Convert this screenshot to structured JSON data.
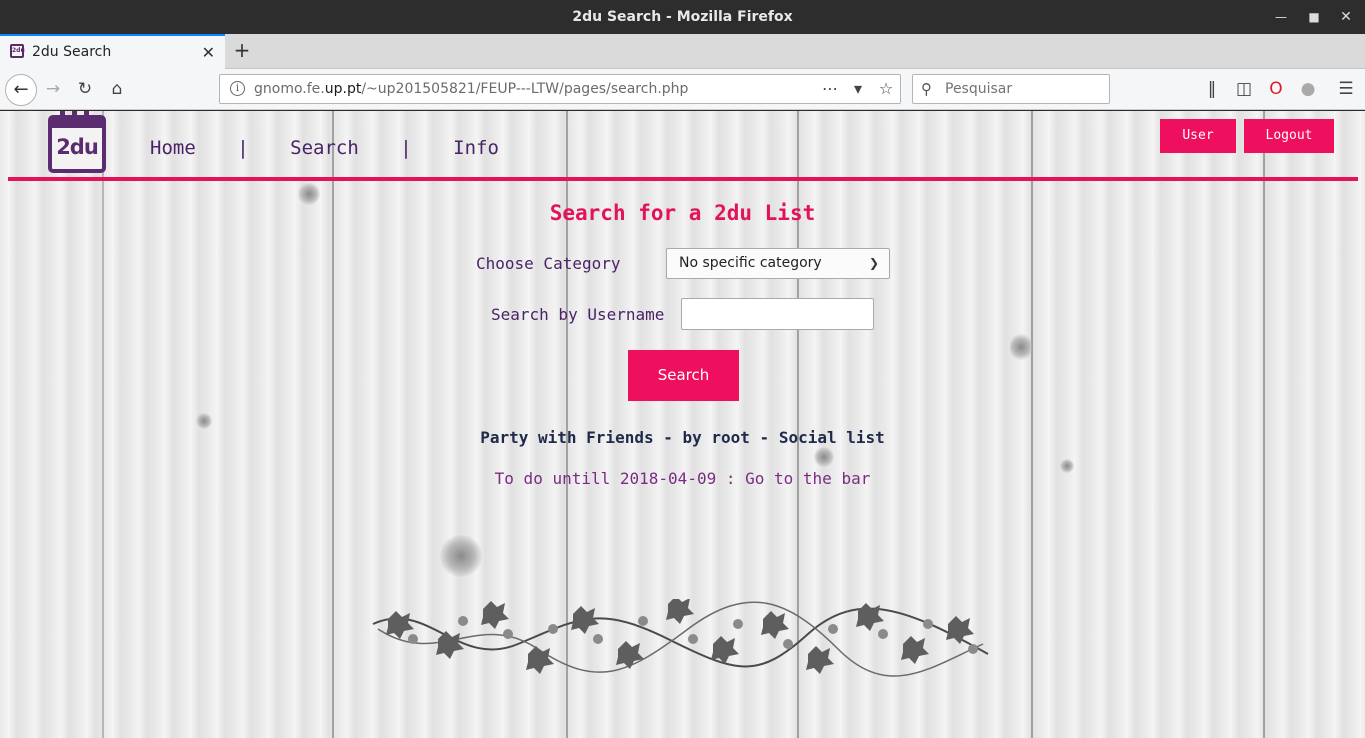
{
  "window": {
    "title": "2du Search - Mozilla Firefox"
  },
  "browser": {
    "tab_title": "2du Search",
    "url_host_prefix": "gnomo.fe.",
    "url_host_domain": "up.pt",
    "url_path": "/~up201505821/FEUP---LTW/pages/search.php",
    "search_placeholder": "Pesquisar"
  },
  "site": {
    "logo_text": "2du",
    "nav": [
      {
        "label": "Home"
      },
      {
        "label": "|"
      },
      {
        "label": "Search"
      },
      {
        "label": "|"
      },
      {
        "label": "Info"
      }
    ],
    "user_button": "User",
    "logout_button": "Logout"
  },
  "search_form": {
    "heading": "Search for a 2du List",
    "category_label": "Choose Category",
    "category_selected": "No specific category",
    "username_label": "Search by Username",
    "username_value": "",
    "submit_label": "Search"
  },
  "results": [
    {
      "title": "Party with Friends - by root - Social list",
      "items": [
        "To do untill 2018-04-09 : Go to the bar"
      ]
    }
  ],
  "colors": {
    "accent": "#ee0f5e",
    "brand_purple": "#4a2366"
  },
  "icons": [
    "back-icon",
    "forward-icon",
    "reload-icon",
    "home-icon",
    "info-icon",
    "more-actions-icon",
    "pocket-icon",
    "star-icon",
    "search-icon",
    "library-icon",
    "sidebar-icon",
    "opera-icon",
    "globe-icon",
    "menu-icon"
  ]
}
